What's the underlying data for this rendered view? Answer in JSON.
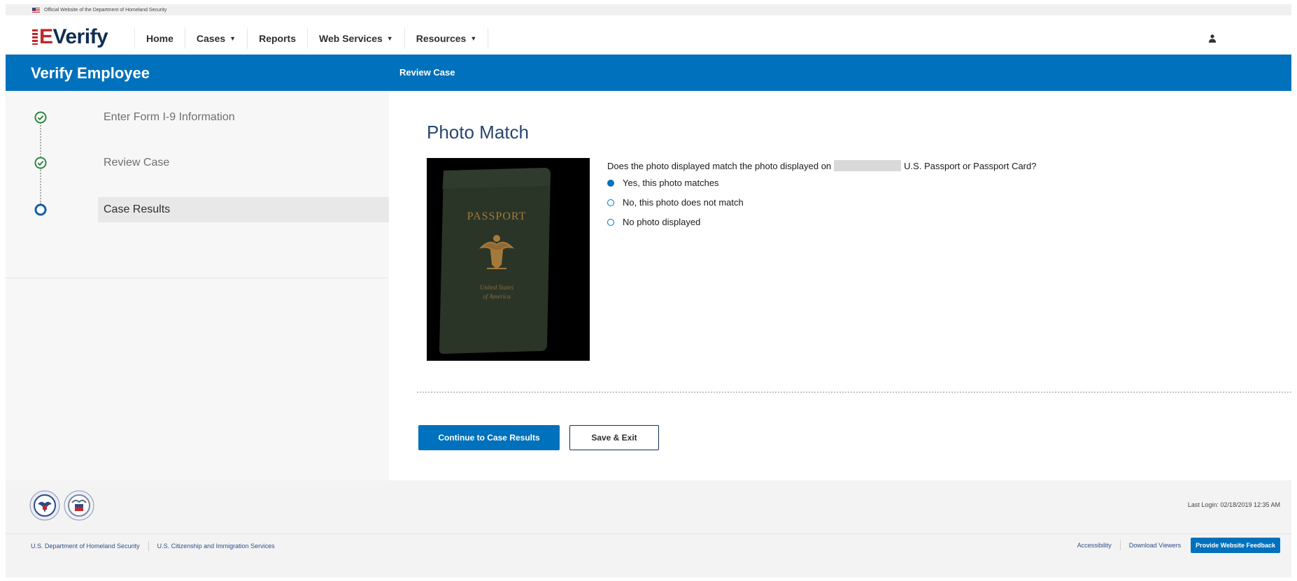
{
  "gov_banner": {
    "text": "Official Website of the Department of Homeland Security"
  },
  "brand": {
    "logo_prefix": "E",
    "logo_suffix": "Verify"
  },
  "nav": {
    "items": [
      {
        "label": "Home"
      },
      {
        "label": "Cases",
        "caret": "▼"
      },
      {
        "label": "Reports"
      },
      {
        "label": "Web Services",
        "caret": "▼"
      },
      {
        "label": "Resources",
        "caret": "▼"
      }
    ]
  },
  "header": {
    "title": "Verify Employee",
    "subtitle": "Review Case"
  },
  "sidebar": {
    "steps": [
      {
        "label": "Enter Form I-9 Information",
        "status": "complete"
      },
      {
        "label": "Review Case",
        "status": "complete"
      },
      {
        "label": "Case Results",
        "status": "current"
      }
    ]
  },
  "main": {
    "title": "Photo Match",
    "photo": {
      "cover_title": "PASSPORT",
      "cover_line1": "United States",
      "cover_line2": "of America"
    },
    "question_before": "Does the photo displayed match the photo displayed on",
    "question_after": "U.S. Passport or Passport Card?",
    "options": [
      {
        "label": "Yes, this photo matches",
        "checked": true
      },
      {
        "label": "No, this photo does not match",
        "checked": false
      },
      {
        "label": "No photo displayed",
        "checked": false
      }
    ],
    "continue_label": "Continue to Case Results",
    "save_exit_label": "Save & Exit"
  },
  "footer": {
    "last_login": "Last Login: 02/18/2019 12:35 AM",
    "links_left": [
      "U.S. Department of Homeland Security",
      "U.S. Citizenship and Immigration Services"
    ],
    "links_right": [
      "Accessibility",
      "Download Viewers"
    ],
    "feedback_label": "Provide Website Feedback"
  },
  "colors": {
    "brand_blue": "#0071bc",
    "navy": "#112e51",
    "red": "#c0282d",
    "success_green": "#2e8540"
  }
}
